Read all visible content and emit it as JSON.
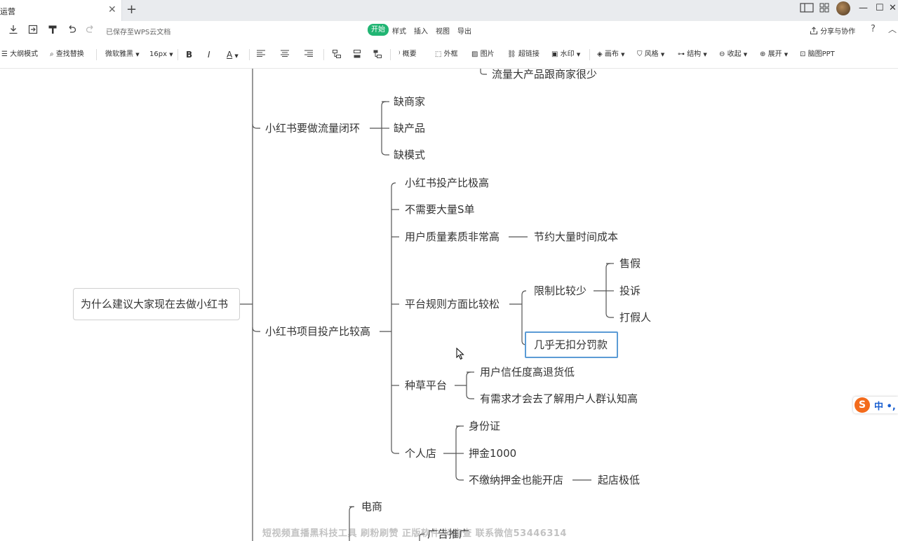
{
  "titlebar": {
    "tab_title": "运营",
    "close_glyph": "✕",
    "add_glyph": "+",
    "win": {
      "minimize": "—",
      "maximize": "☐",
      "close": "✕"
    }
  },
  "menubar": {
    "saved_status": "已保存至WPS云文档",
    "items": [
      "开始",
      "样式",
      "插入",
      "视图",
      "导出"
    ],
    "active_item": "开始",
    "share_label": "分享与协作",
    "help_label": "?",
    "collapse_label": "︿"
  },
  "toolbar": {
    "outline_mode": "大纲模式",
    "find_replace": "查找替换",
    "font_family": "微软雅黑",
    "font_size": "16px",
    "bold": "B",
    "italic": "I",
    "font_color": "A",
    "summary": "概要",
    "frame": "外框",
    "image": "图片",
    "hyperlink": "超链接",
    "watermark": "水印",
    "canvas": "画布",
    "style": "风格",
    "structure": "结构",
    "collapse_all": "收起",
    "expand_all": "展开",
    "to_ppt": "脑图PPT"
  },
  "mindmap": {
    "top_partial": "流量大产品跟商家很少",
    "root": "为什么建议大家现在去做小红书",
    "loop": {
      "label": "小红书要做流量闭环",
      "children": [
        "缺商家",
        "缺产品",
        "缺模式"
      ]
    },
    "roi": {
      "label": "小红书项目投产比较高",
      "c1": "小红书投产比极高",
      "c2": "不需要大量S单",
      "c3": "用户质量素质非常高",
      "c3_child": "节约大量时间成本",
      "c4": "平台规则方面比较松",
      "c4_limit": "限制比较少",
      "c4_limit_children": [
        "售假",
        "投诉",
        "打假人"
      ],
      "c4_selected": "几乎无扣分罚款",
      "c5": "种草平台",
      "c5_children": [
        "用户信任度高退货低",
        "有需求才会去了解用户人群认知高"
      ],
      "c6": "个人店",
      "c6_children": [
        "身份证",
        "押金1000",
        "不缴纳押金也能开店"
      ],
      "c6_child3_child": "起店极低"
    },
    "bottom_partial": [
      "电商",
      "广告推广"
    ]
  },
  "watermark_text": "短视频直播黑科技工具 刷粉刷赞 正版软件 抖查查 联系微信53446314",
  "ime": {
    "logo": "S",
    "mode": "中 •,"
  },
  "colors": {
    "accent_green": "#21b573",
    "selection_blue": "#5b9bd5",
    "line": "#555555"
  }
}
